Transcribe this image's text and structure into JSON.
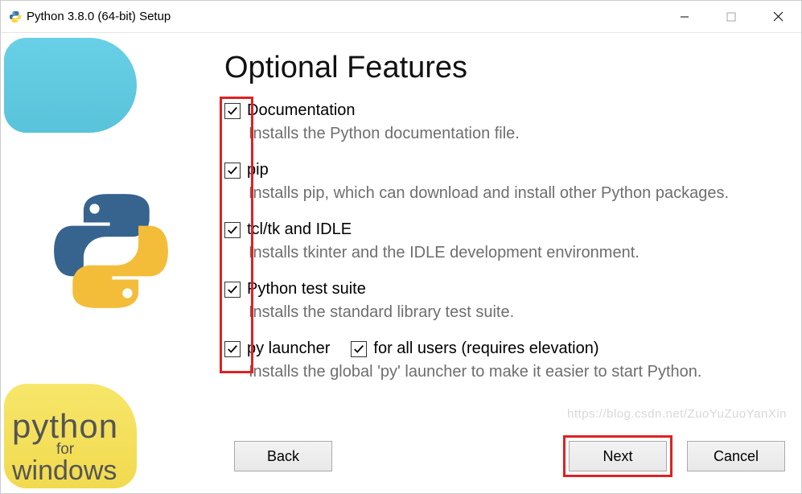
{
  "window": {
    "title": "Python 3.8.0 (64-bit) Setup"
  },
  "heading": "Optional Features",
  "features": {
    "doc": {
      "label": "Documentation",
      "desc": "Installs the Python documentation file."
    },
    "pip": {
      "label": "pip",
      "desc": "Installs pip, which can download and install other Python packages."
    },
    "tcl": {
      "label": "tcl/tk and IDLE",
      "desc": "Installs tkinter and the IDLE development environment."
    },
    "test": {
      "label": "Python test suite",
      "desc": "Installs the standard library test suite."
    },
    "launcher": {
      "label": "py launcher",
      "all_users": "for all users (requires elevation)",
      "desc": "Installs the global 'py' launcher to make it easier to start Python."
    }
  },
  "buttons": {
    "back": "Back",
    "next": "Next",
    "cancel": "Cancel"
  },
  "branding": {
    "line1": "python",
    "line2": "for",
    "line3": "windows"
  },
  "watermark": "https://blog.csdn.net/ZuoYuZuoYanXin"
}
